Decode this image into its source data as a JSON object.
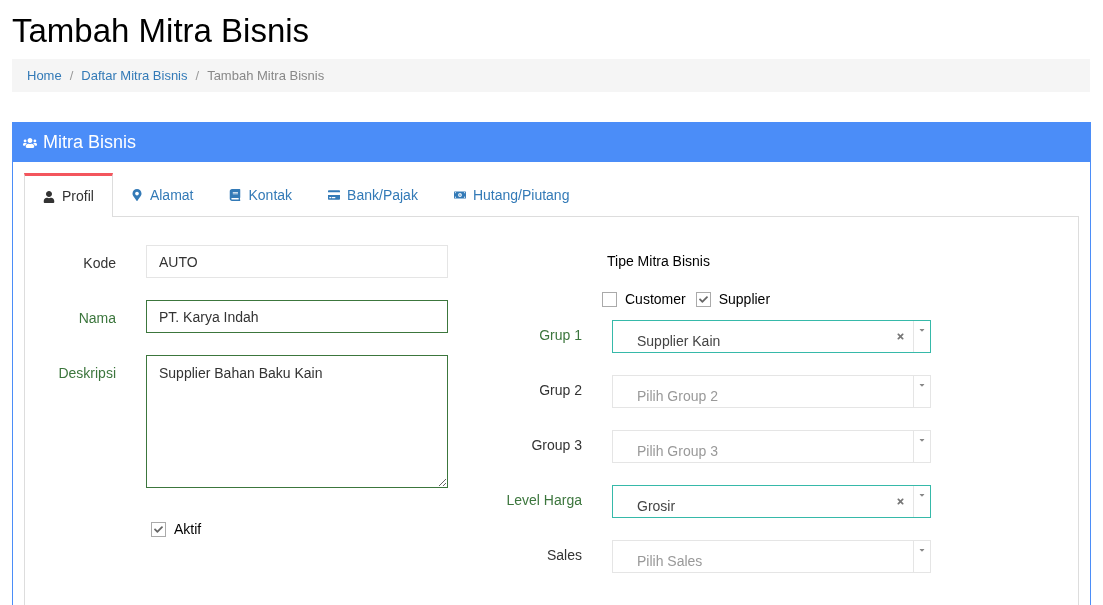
{
  "page_title": "Tambah Mitra Bisnis",
  "breadcrumb_separator": "/",
  "breadcrumb": [
    {
      "label": "Home",
      "current": false
    },
    {
      "label": "Daftar Mitra Bisnis",
      "current": false
    },
    {
      "label": "Tambah Mitra Bisnis",
      "current": true
    }
  ],
  "panel": {
    "title": "Mitra Bisnis",
    "tabs": [
      {
        "label": "Profil",
        "selected": true
      },
      {
        "label": "Alamat",
        "selected": false
      },
      {
        "label": "Kontak",
        "selected": false
      },
      {
        "label": "Bank/Pajak",
        "selected": false
      },
      {
        "label": "Hutang/Piutang",
        "selected": false
      }
    ]
  },
  "fields": [
    {
      "kind": "input",
      "label": "Kode",
      "value": "AUTO",
      "valid": false
    },
    {
      "kind": "input",
      "label": "Nama",
      "value": "PT. Karya Indah",
      "valid": true
    },
    {
      "kind": "textarea",
      "label": "Deskripsi",
      "value": "Supplier Bahan Baku Kain",
      "valid": true
    }
  ],
  "aktif": {
    "label": "Aktif",
    "checked": true
  },
  "tipe": {
    "title": "Tipe Mitra Bisnis",
    "options": [
      {
        "label": "Customer",
        "checked": false
      },
      {
        "label": "Supplier",
        "checked": true
      }
    ]
  },
  "selects": [
    {
      "label": "Grup 1",
      "value": "Supplier Kain",
      "valid": true
    },
    {
      "label": "Grup 2",
      "placeholder": "Pilih Group 2",
      "valid": false
    },
    {
      "label": "Group 3",
      "placeholder": "Pilih Group 3",
      "valid": false
    },
    {
      "label": "Level Harga",
      "value": "Grosir",
      "valid": true
    },
    {
      "label": "Sales",
      "placeholder": "Pilih Sales",
      "valid": false
    }
  ]
}
